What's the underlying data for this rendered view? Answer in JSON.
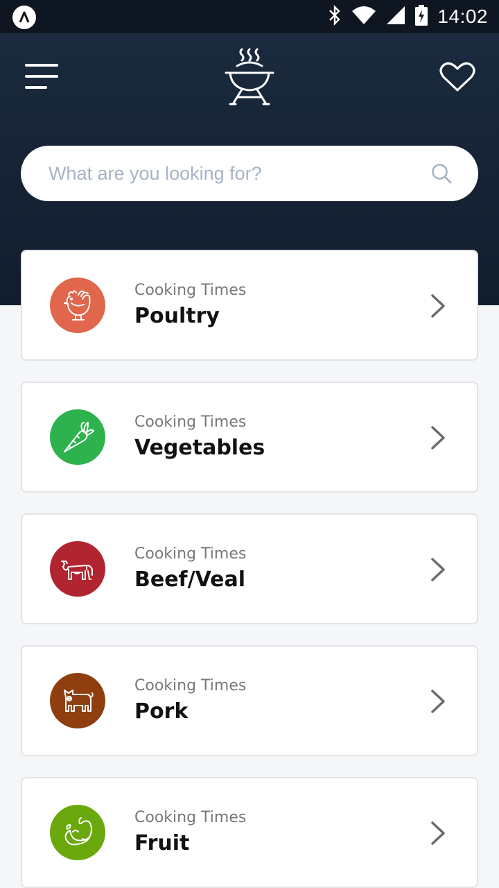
{
  "status_bar": {
    "time": "14:02",
    "icons": [
      "app-badge-icon",
      "bluetooth-icon",
      "wifi-icon",
      "signal-icon",
      "battery-charging-icon"
    ]
  },
  "header": {
    "menu_icon": "hamburger-icon",
    "logo_icon": "grill-icon",
    "favorites_icon": "heart-icon",
    "background": "#152235"
  },
  "search": {
    "placeholder": "What are you looking for?",
    "value": "",
    "icon": "search-icon"
  },
  "categories": [
    {
      "subtitle": "Cooking Times",
      "title": "Poultry",
      "icon": "chicken-icon",
      "color": "#e0664c"
    },
    {
      "subtitle": "Cooking Times",
      "title": "Vegetables",
      "icon": "carrot-icon",
      "color": "#2db24e"
    },
    {
      "subtitle": "Cooking Times",
      "title": "Beef/Veal",
      "icon": "cow-icon",
      "color": "#b02530"
    },
    {
      "subtitle": "Cooking Times",
      "title": "Pork",
      "icon": "pig-icon",
      "color": "#8f3e10"
    },
    {
      "subtitle": "Cooking Times",
      "title": "Fruit",
      "icon": "fruit-icon",
      "color": "#6aa80e"
    }
  ]
}
